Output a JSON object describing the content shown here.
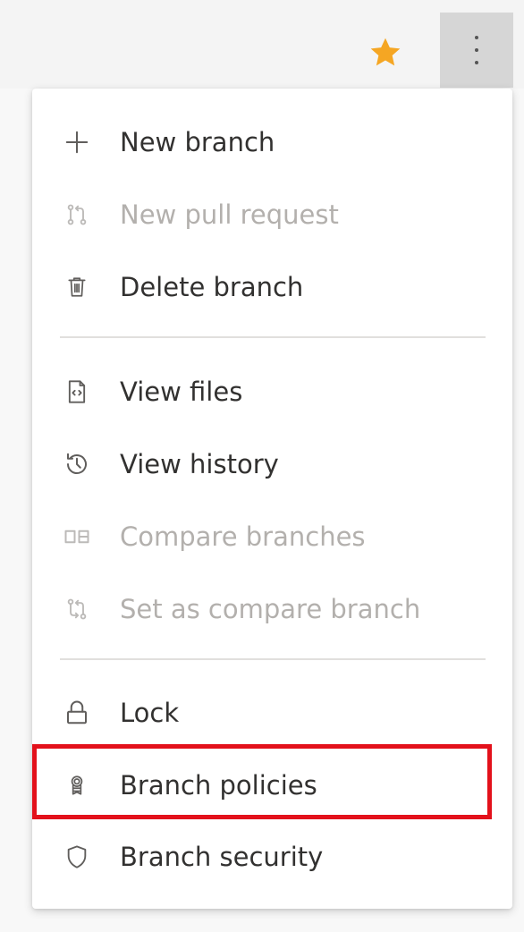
{
  "toolbar": {
    "favorite_icon": "star-icon",
    "favorite_color": "#f5a623",
    "more_icon": "more-vertical-icon"
  },
  "menu": {
    "groups": [
      [
        {
          "label": "New branch",
          "icon": "plus-icon",
          "enabled": true
        },
        {
          "label": "New pull request",
          "icon": "pull-request-icon",
          "enabled": false
        },
        {
          "label": "Delete branch",
          "icon": "trash-icon",
          "enabled": true
        }
      ],
      [
        {
          "label": "View files",
          "icon": "file-code-icon",
          "enabled": true
        },
        {
          "label": "View history",
          "icon": "history-icon",
          "enabled": true
        },
        {
          "label": "Compare branches",
          "icon": "compare-icon",
          "enabled": false
        },
        {
          "label": "Set as compare branch",
          "icon": "compare-branch-icon",
          "enabled": false
        }
      ],
      [
        {
          "label": "Lock",
          "icon": "lock-icon",
          "enabled": true
        },
        {
          "label": "Branch policies",
          "icon": "policy-badge-icon",
          "enabled": true,
          "highlighted": true
        },
        {
          "label": "Branch security",
          "icon": "shield-icon",
          "enabled": true
        }
      ]
    ]
  },
  "highlight_color": "#e3111b"
}
